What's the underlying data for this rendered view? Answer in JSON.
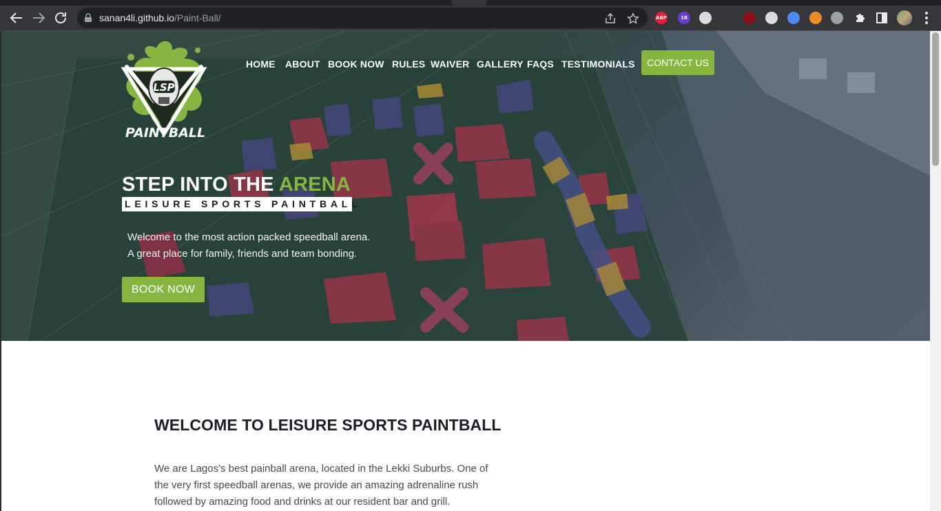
{
  "browser": {
    "url_host": "sanan4li.github.io",
    "url_path": "/Paint-Ball/",
    "extensions": [
      {
        "name": "adblock-plus-icon",
        "label": "ABP",
        "color": "#e0203b"
      },
      {
        "name": "badge-extension-icon",
        "label": "18",
        "color": "#6a3dd0"
      },
      {
        "name": "extension-circle-icon",
        "label": "",
        "color": "#dadce0"
      },
      {
        "name": "react-devtools-icon",
        "label": "",
        "color": "#35363a"
      },
      {
        "name": "record-extension-icon",
        "label": "",
        "color": "#8a0f14"
      },
      {
        "name": "translate-extension-icon",
        "label": "",
        "color": "#dadce0"
      },
      {
        "name": "tools-extension-icon",
        "label": "",
        "color": "#4a8af4"
      },
      {
        "name": "rss-extension-icon",
        "label": "",
        "color": "#f08a24"
      },
      {
        "name": "globe-extension-icon",
        "label": "",
        "color": "#9aa0a6"
      }
    ]
  },
  "nav": {
    "links": [
      "HOME",
      "ABOUT",
      "BOOK NOW",
      "RULES",
      "WAIVER",
      "GALLERY",
      "FAQS",
      "TESTIMONIALS"
    ],
    "contact_label": "CONTACT US"
  },
  "logo": {
    "initials": "LSP",
    "word": "PAINTBALL"
  },
  "hero": {
    "title_main": "STEP INTO THE ",
    "title_accent": "ARENA",
    "subtitle": "LEISURE SPORTS PAINTBALL",
    "line1": "Welcome to the most action packed speedball arena.",
    "line2": "A great place for family, friends and team bonding.",
    "cta_label": "BOOK NOW"
  },
  "welcome": {
    "title": "WELCOME TO LEISURE SPORTS PAINTBALL",
    "lines": [
      "We are Lagos's best painball arena, located in the Lekki Suburbs. One of",
      "the very first speedball arenas, we provide an amazing adrenaline rush",
      "followed by amazing food and drinks at our resident bar and grill."
    ]
  },
  "colors": {
    "accent": "#86b542",
    "chrome": "#35363a",
    "omnibox": "#202124"
  }
}
